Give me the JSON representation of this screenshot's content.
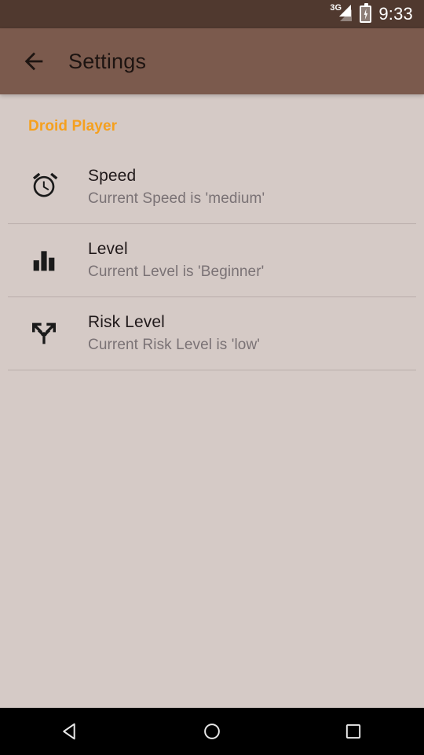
{
  "status_bar": {
    "network_type": "3G",
    "signal_icon": "signal-triangle-icon",
    "battery_icon": "battery-charging-icon",
    "time": "9:33",
    "background_color": "#50392F"
  },
  "app_bar": {
    "back_icon": "arrow-back-icon",
    "title": "Settings",
    "background_color": "#7B5A4D",
    "title_color": "#1D1411"
  },
  "content": {
    "background_color": "#D5CAC6",
    "category": {
      "label": "Droid Player",
      "color": "#F5A01E"
    },
    "preferences": [
      {
        "icon": "alarm-clock-icon",
        "title": "Speed",
        "summary": "Current Speed is 'medium'"
      },
      {
        "icon": "bar-chart-icon",
        "title": "Level",
        "summary": "Current Level is 'Beginner'"
      },
      {
        "icon": "call-split-icon",
        "title": "Risk Level",
        "summary": "Current Risk Level is 'low'"
      }
    ]
  },
  "nav_bar": {
    "background_color": "#000000",
    "buttons": [
      {
        "icon": "nav-back-icon",
        "label": "Back"
      },
      {
        "icon": "nav-home-icon",
        "label": "Home"
      },
      {
        "icon": "nav-recents-icon",
        "label": "Recents"
      }
    ]
  }
}
